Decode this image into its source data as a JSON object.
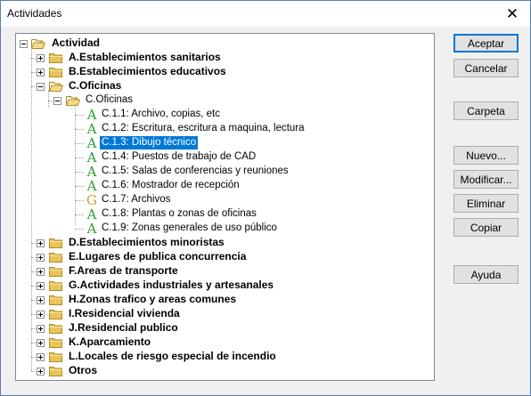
{
  "window": {
    "title": "Actividades",
    "close_glyph": "✕"
  },
  "tree": {
    "root": "Actividad",
    "groups": [
      "A.Establecimientos sanitarios",
      "B.Establecimientos educativos",
      "C.Oficinas",
      "D.Establecimientos minoristas",
      "E.Lugares de publica concurrencia",
      "F.Areas de transporte",
      "G.Actividades industriales y artesanales",
      "H.Zonas trafico y areas comunes",
      "I.Residencial vivienda",
      "J.Residencial publico",
      "K.Aparcamiento",
      "L.Locales de riesgo especial de incendio",
      "Otros"
    ],
    "subgroup": "C.Oficinas",
    "items": [
      {
        "label": "C.1.1: Archivo, copias, etc",
        "icon": "A",
        "color": "#2f9e2f"
      },
      {
        "label": "C.1.2: Escritura, escritura a maquina, lectura",
        "icon": "A",
        "color": "#2f9e2f"
      },
      {
        "label": "C.1.3: Dibujo técnico",
        "icon": "A",
        "color": "#2f9e2f"
      },
      {
        "label": "C.1.4: Puestos de trabajo de CAD",
        "icon": "A",
        "color": "#2f9e2f"
      },
      {
        "label": "C.1.5: Salas de conferencias y reuniones",
        "icon": "A",
        "color": "#2f9e2f"
      },
      {
        "label": "C.1.6: Mostrador de recepción",
        "icon": "A",
        "color": "#2f9e2f"
      },
      {
        "label": "C.1.7: Archivos",
        "icon": "G",
        "color": "#c9a326"
      },
      {
        "label": "C.1.8: Plantas o zonas de oficinas",
        "icon": "A",
        "color": "#2f9e2f"
      },
      {
        "label": "C.1.9: Zonas generales de uso público",
        "icon": "A",
        "color": "#2f9e2f"
      }
    ],
    "selected_item": 2
  },
  "buttons": {
    "aceptar": "Aceptar",
    "cancelar": "Cancelar",
    "carpeta": "Carpeta",
    "nuevo": "Nuevo...",
    "modificar": "Modificar...",
    "eliminar": "Eliminar",
    "copiar": "Copiar",
    "ayuda": "Ayuda"
  },
  "colors": {
    "selection": "#0078d7",
    "folder": "#e8c45a",
    "accent": "#0078d7"
  }
}
